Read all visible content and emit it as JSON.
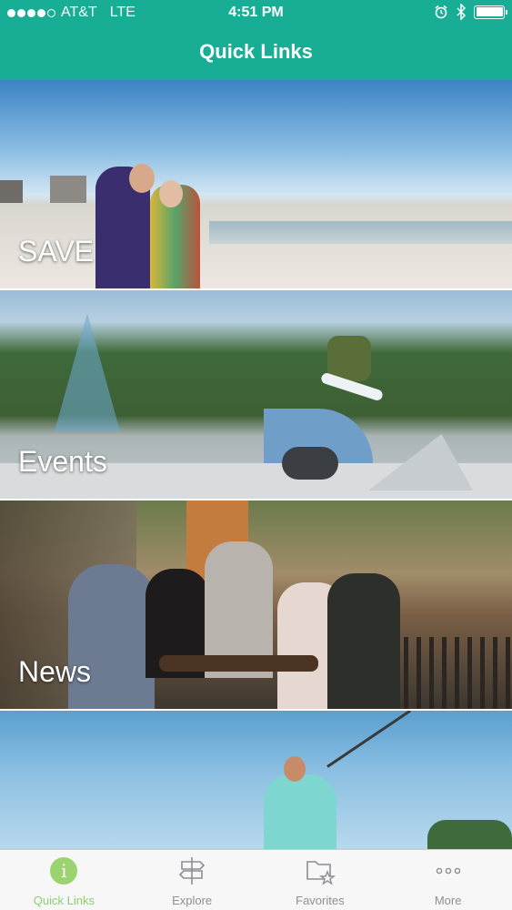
{
  "status_bar": {
    "carrier": "AT&T",
    "network": "LTE",
    "time": "4:51 PM"
  },
  "header": {
    "title": "Quick Links"
  },
  "tiles": [
    {
      "label": "SAVE"
    },
    {
      "label": "Events"
    },
    {
      "label": "News"
    },
    {
      "label": ""
    }
  ],
  "tabbar": {
    "tabs": [
      {
        "label": "Quick Links",
        "icon": "info-icon",
        "active": true
      },
      {
        "label": "Explore",
        "icon": "signpost-icon",
        "active": false
      },
      {
        "label": "Favorites",
        "icon": "folder-star-icon",
        "active": false
      },
      {
        "label": "More",
        "icon": "more-dots-icon",
        "active": false
      }
    ],
    "active_color": "#8ccf6a",
    "inactive_color": "#8e8e93"
  },
  "colors": {
    "header_background": "#17ae95"
  }
}
